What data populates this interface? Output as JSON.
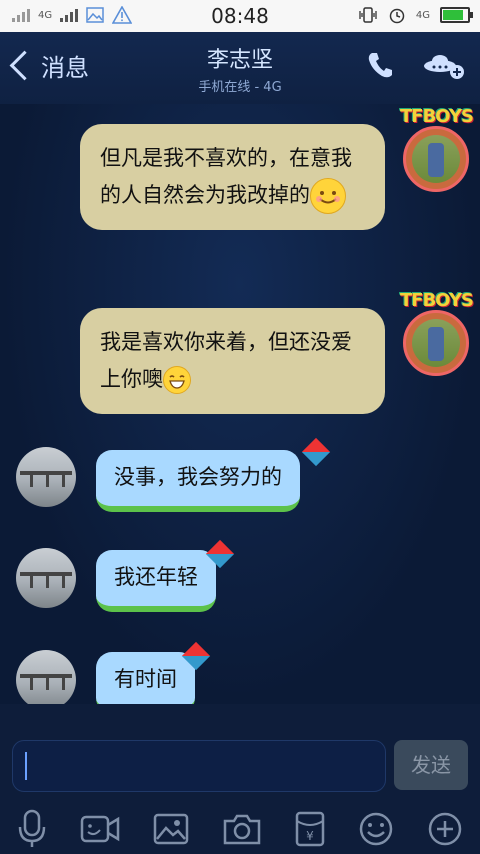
{
  "status_bar": {
    "time": "08:48",
    "net_label_1": "4G",
    "net_label_2": "4G",
    "battery_level": 0.9
  },
  "header": {
    "back_label": "消息",
    "contact_name": "李志坚",
    "contact_status": "手机在线 - 4G"
  },
  "messages": [
    {
      "side": "right",
      "text": "但凡是我不喜欢的，在意我的人自然会为我改掉的",
      "avatar_badge": "TFBOYS"
    },
    {
      "side": "right",
      "text": "我是喜欢你来着，但还没爱上你噢",
      "avatar_badge": "TFBOYS"
    },
    {
      "side": "left",
      "text": "没事，我会努力的"
    },
    {
      "side": "left",
      "text": "我还年轻"
    },
    {
      "side": "left",
      "text": "有时间"
    }
  ],
  "input": {
    "value": "",
    "send_label": "发送"
  },
  "toolbar": [
    "microphone-icon",
    "video-icon",
    "image-icon",
    "camera-icon",
    "red-packet-icon",
    "emoji-icon",
    "plus-icon"
  ],
  "colors": {
    "header_bg": "#13284f",
    "outgoing_bubble": "#d8cfa2",
    "incoming_bubble": "#a9d9ff",
    "battery": "#2fbf3a"
  }
}
